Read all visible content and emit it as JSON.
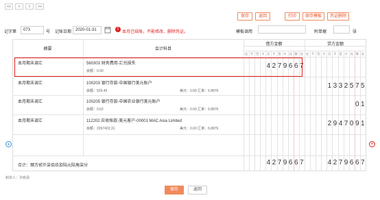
{
  "nav": {
    "first": "<<",
    "prev": "<",
    "next": ">",
    "last": ">>"
  },
  "toolbar": {
    "save": "保存",
    "back": "返回",
    "print": "打印",
    "save_template": "保存模板",
    "voucher_delete": "凭证删除"
  },
  "header": {
    "voucher_word_label": "记字第",
    "voucher_no": "073",
    "no_suffix": "号",
    "date_label": "记账日期",
    "date": "2020-01-31",
    "warning": "本月已结账，不能修改、删除凭证。",
    "template_label": "模板调用",
    "attach_label": "附单据",
    "attach_unit": "张"
  },
  "table": {
    "col_summary": "摘要",
    "col_account": "会计科目",
    "col_debit": "借方金额",
    "col_credit": "贷方金额",
    "digit_units": [
      "亿",
      "千",
      "百",
      "十",
      "万",
      "千",
      "百",
      "十",
      "元",
      "角",
      "分"
    ],
    "rows": [
      {
        "summary": "本月期末调汇",
        "account": "560303 财务费用-汇兑损失",
        "balance": "余额：0.00",
        "fx": "",
        "debit": "427 9667",
        "credit": ""
      },
      {
        "summary": "本月期末调汇",
        "account": "100203 银行存款-中国银行美元账户",
        "balance": "余额：529.45",
        "fx": "美元：0.00 汇率：6.8876",
        "debit": "",
        "credit": "1332575"
      },
      {
        "summary": "本月期末调汇",
        "account": "100205 银行存款-中国农业银行美元账户",
        "balance": "余额：0.62",
        "fx": "美元：0.00 汇率：6.8876",
        "debit": "",
        "credit": "01"
      },
      {
        "summary": "本月期末调汇",
        "account": "112202 应收账款-美元客户-00001 MAC Asia Limited",
        "balance": "余额：2297423.31",
        "fx": "美元：0.00 汇率：6.8876",
        "debit": "",
        "credit": "2947091"
      }
    ],
    "total_label": "合计：肆万贰仟柒佰玖拾陆元陆角柒分",
    "total_debit": "4279667",
    "total_credit": "4279667"
  },
  "footer": {
    "maker": "制单人：孙奕潇",
    "save": "保存",
    "back": "返回"
  },
  "icons": {
    "calendar": "calendar-icon",
    "warning": "warning-icon",
    "add": "add-row-icon",
    "remove": "remove-row-icon"
  },
  "colors": {
    "accent": "#e8552b",
    "highlight_border": "#e02020"
  }
}
